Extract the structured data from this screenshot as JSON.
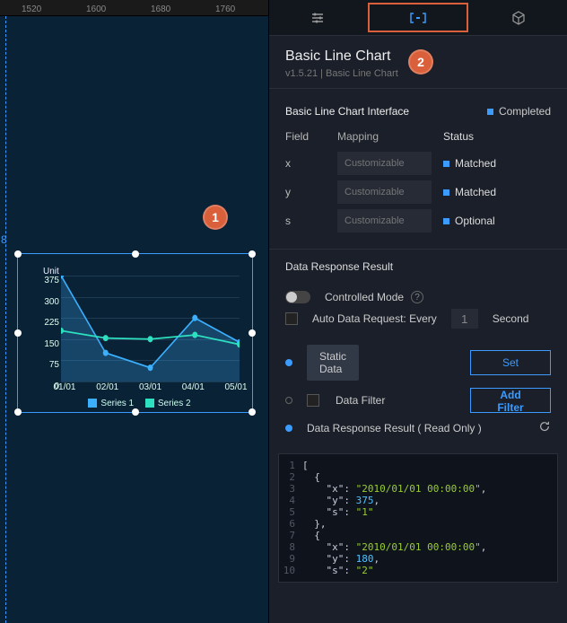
{
  "ruler": {
    "ticks": [
      "1520",
      "1600",
      "1680",
      "1760"
    ]
  },
  "guide": {
    "label": "8"
  },
  "callouts": {
    "one": "1",
    "two": "2"
  },
  "chart_data": {
    "type": "line",
    "title": "Unit",
    "ylim": [
      0,
      375
    ],
    "yticks": [
      375,
      300,
      225,
      150,
      75,
      0
    ],
    "categories": [
      "01/01",
      "02/01",
      "03/01",
      "04/01",
      "05/01"
    ],
    "series": [
      {
        "name": "Series 1",
        "values": [
          375,
          100,
          50,
          225,
          140
        ]
      },
      {
        "name": "Series 2",
        "values": [
          180,
          155,
          150,
          165,
          130
        ]
      }
    ],
    "legend_labels": [
      "Series 1",
      "Series 2"
    ]
  },
  "panel": {
    "title": "Basic Line Chart",
    "version": "v1.5.21 | Basic Line Chart",
    "interface_label": "Basic Line Chart Interface",
    "completed_label": "Completed",
    "cols": {
      "field": "Field",
      "mapping": "Mapping",
      "status": "Status"
    },
    "fields": [
      {
        "name": "x",
        "placeholder": "Customizable",
        "status": "Matched"
      },
      {
        "name": "y",
        "placeholder": "Customizable",
        "status": "Matched"
      },
      {
        "name": "s",
        "placeholder": "Customizable",
        "status": "Optional"
      }
    ],
    "resp_title": "Data Response Result",
    "controlled_label": "Controlled Mode",
    "auto_label": "Auto Data Request: Every",
    "auto_num": "1",
    "auto_unit": "Second",
    "static_label": "Static Data",
    "set_btn": "Set",
    "filter_label": "Data Filter",
    "add_filter_btn": "Add Filter",
    "readonly_label": "Data Response Result ( Read Only )",
    "code": {
      "lines": [
        "[",
        "  {",
        "    \"x\": \"2010/01/01 00:00:00\",",
        "    \"y\": 375,",
        "    \"s\": \"1\"",
        "  },",
        "  {",
        "    \"x\": \"2010/01/01 00:00:00\",",
        "    \"y\": 180,",
        "    \"s\": \"2\""
      ]
    }
  }
}
